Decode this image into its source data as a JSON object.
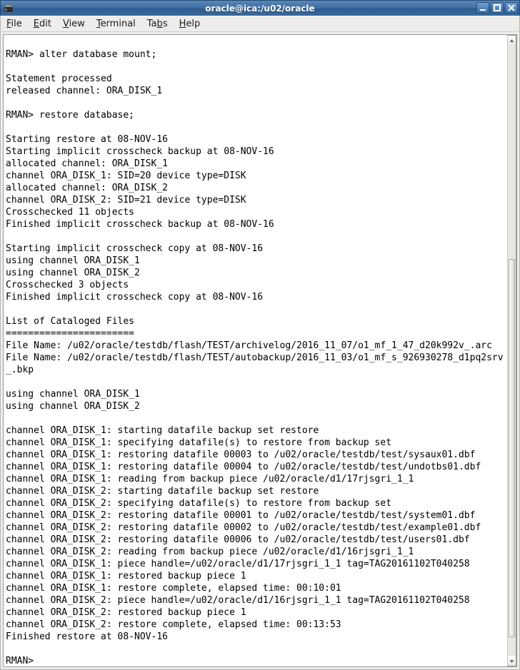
{
  "window": {
    "title": "oracle@ica:/u02/oracle"
  },
  "menubar": {
    "items": [
      {
        "pre": "",
        "ul": "F",
        "post": "ile"
      },
      {
        "pre": "",
        "ul": "E",
        "post": "dit"
      },
      {
        "pre": "",
        "ul": "V",
        "post": "iew"
      },
      {
        "pre": "",
        "ul": "T",
        "post": "erminal"
      },
      {
        "pre": "Ta",
        "ul": "b",
        "post": "s"
      },
      {
        "pre": "",
        "ul": "H",
        "post": "elp"
      }
    ]
  },
  "terminal": {
    "content": "\nRMAN> alter database mount;\n\nStatement processed\nreleased channel: ORA_DISK_1\n\nRMAN> restore database;\n\nStarting restore at 08-NOV-16\nStarting implicit crosscheck backup at 08-NOV-16\nallocated channel: ORA_DISK_1\nchannel ORA_DISK_1: SID=20 device type=DISK\nallocated channel: ORA_DISK_2\nchannel ORA_DISK_2: SID=21 device type=DISK\nCrosschecked 11 objects\nFinished implicit crosscheck backup at 08-NOV-16\n\nStarting implicit crosscheck copy at 08-NOV-16\nusing channel ORA_DISK_1\nusing channel ORA_DISK_2\nCrosschecked 3 objects\nFinished implicit crosscheck copy at 08-NOV-16\n\nList of Cataloged Files\n=======================\nFile Name: /u02/oracle/testdb/flash/TEST/archivelog/2016_11_07/o1_mf_1_47_d20k992v_.arc\nFile Name: /u02/oracle/testdb/flash/TEST/autobackup/2016_11_03/o1_mf_s_926930278_d1pq2srv_.bkp\n\nusing channel ORA_DISK_1\nusing channel ORA_DISK_2\n\nchannel ORA_DISK_1: starting datafile backup set restore\nchannel ORA_DISK_1: specifying datafile(s) to restore from backup set\nchannel ORA_DISK_1: restoring datafile 00003 to /u02/oracle/testdb/test/sysaux01.dbf\nchannel ORA_DISK_1: restoring datafile 00004 to /u02/oracle/testdb/test/undotbs01.dbf\nchannel ORA_DISK_1: reading from backup piece /u02/oracle/d1/17rjsgri_1_1\nchannel ORA_DISK_2: starting datafile backup set restore\nchannel ORA_DISK_2: specifying datafile(s) to restore from backup set\nchannel ORA_DISK_2: restoring datafile 00001 to /u02/oracle/testdb/test/system01.dbf\nchannel ORA_DISK_2: restoring datafile 00002 to /u02/oracle/testdb/test/example01.dbf\nchannel ORA_DISK_2: restoring datafile 00006 to /u02/oracle/testdb/test/users01.dbf\nchannel ORA_DISK_2: reading from backup piece /u02/oracle/d1/16rjsgri_1_1\nchannel ORA_DISK_1: piece handle=/u02/oracle/d1/17rjsgri_1_1 tag=TAG20161102T040258\nchannel ORA_DISK_1: restored backup piece 1\nchannel ORA_DISK_1: restore complete, elapsed time: 00:10:01\nchannel ORA_DISK_2: piece handle=/u02/oracle/d1/16rjsgri_1_1 tag=TAG20161102T040258\nchannel ORA_DISK_2: restored backup piece 1\nchannel ORA_DISK_2: restore complete, elapsed time: 00:13:53\nFinished restore at 08-NOV-16\n\nRMAN>"
  }
}
